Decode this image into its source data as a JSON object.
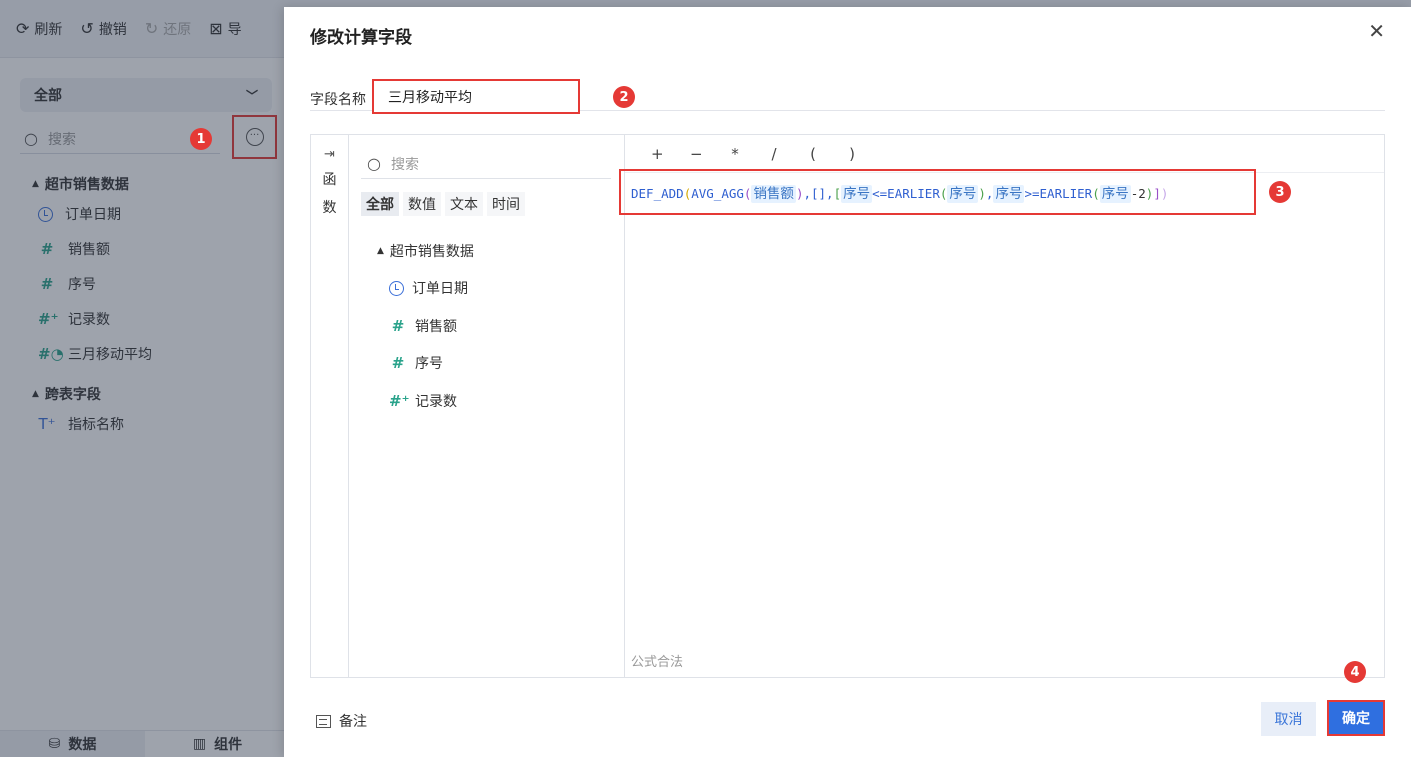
{
  "toolbar": {
    "refresh": "刷新",
    "undo": "撤销",
    "redo": "还原",
    "export_partial": "导"
  },
  "left_panel": {
    "select_value": "全部",
    "search_placeholder": "搜索",
    "groups": [
      {
        "title": "超市销售数据",
        "items": [
          {
            "label": "订单日期",
            "icon": "clock-icon"
          },
          {
            "label": "销售额",
            "icon": "hash-icon"
          },
          {
            "label": "序号",
            "icon": "hash-icon"
          },
          {
            "label": "记录数",
            "icon": "hash-plus-icon"
          },
          {
            "label": "三月移动平均",
            "icon": "hash-formula-icon"
          }
        ]
      },
      {
        "title": "跨表字段",
        "items": [
          {
            "label": "指标名称",
            "icon": "text-plus-icon"
          }
        ]
      }
    ],
    "bottom_tabs": [
      "数据",
      "组件"
    ]
  },
  "badges": [
    "1",
    "2",
    "3",
    "4"
  ],
  "dialog": {
    "title": "修改计算字段",
    "close_icon": "close-icon",
    "field_name_label": "字段名称",
    "field_name_value": "三月移动平均",
    "rail_label": [
      "函",
      "数"
    ],
    "function_panel": {
      "search_placeholder": "搜索",
      "tabs": [
        "全部",
        "数值",
        "文本",
        "时间"
      ],
      "active_tab": "全部",
      "tree_group": "超市销售数据",
      "tree_items": [
        {
          "label": "订单日期",
          "icon": "clock-icon"
        },
        {
          "label": "销售额",
          "icon": "hash-icon"
        },
        {
          "label": "序号",
          "icon": "hash-icon"
        },
        {
          "label": "记录数",
          "icon": "hash-plus-icon"
        }
      ]
    },
    "operators": [
      "+",
      "−",
      "*",
      "/",
      "(",
      ")"
    ],
    "formula": {
      "fn_def_add": "DEF_ADD",
      "fn_avg_agg": "AVG_AGG",
      "fn_earlier": "EARLIER",
      "field_sales": "销售额",
      "field_seq": "序号",
      "sep_empty": ",[],",
      "op_le": "<=",
      "op_ge": ">=",
      "comma": ",",
      "minus_two": "-2"
    },
    "status_text": "公式合法",
    "note_label": "备注",
    "cancel_label": "取消",
    "ok_label": "确定"
  },
  "colors": {
    "accent": "#2f6fe0",
    "highlight_border": "#e53935",
    "field_icon": "#2aa38b"
  }
}
